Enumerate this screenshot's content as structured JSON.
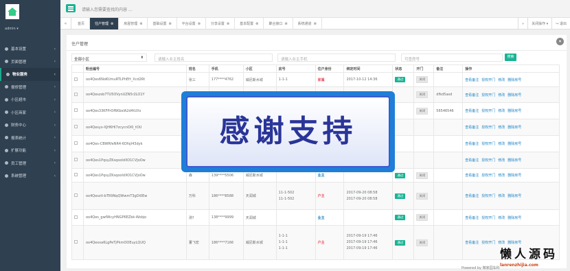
{
  "sidebar": {
    "username": "admin ▾",
    "items": [
      {
        "label": "基本设置",
        "active": false
      },
      {
        "label": "页面管理",
        "active": false
      },
      {
        "label": "物业服务",
        "active": true
      },
      {
        "label": "报修管理",
        "active": false
      },
      {
        "label": "小区超市",
        "active": false
      },
      {
        "label": "小区商家",
        "active": false
      },
      {
        "label": "财务中心",
        "active": false
      },
      {
        "label": "报表统计",
        "active": false
      },
      {
        "label": "扩展功能",
        "active": false
      },
      {
        "label": "员工管理",
        "active": false
      },
      {
        "label": "系统管理",
        "active": false
      }
    ]
  },
  "topbar": {
    "search_placeholder": "请输入您需要查找的内容 ..."
  },
  "tabs": {
    "items": [
      "首页",
      "住户管理",
      "房屋管理",
      "基础设置",
      "平台设置",
      "分享设置",
      "基本配置",
      "聚合接口",
      "系统通道"
    ],
    "active_index": 1,
    "close_ops": "关闭操作 ▾",
    "exit": "退出"
  },
  "panel": {
    "title": "住户管理",
    "filter": {
      "select_value": "全部小区",
      "name_placeholder": "请输入业主姓名",
      "phone_placeholder": "请输入业主手机",
      "room_placeholder": "可查房号",
      "search_label": "搜索"
    },
    "columns": [
      "",
      "粉丝编号",
      "姓名",
      "手机",
      "小区",
      "房号",
      "住户身份",
      "绑定时间",
      "状态",
      "开门",
      "备注",
      "操作"
    ],
    "rows": [
      {
        "openid": "oo4Qes6NoKUmuRTLPhEH_Xcd2Rt",
        "name": "张三",
        "phone": "177****4762",
        "estate": "威尼斯水城",
        "rooms": [
          "1-1-1"
        ],
        "role": "家属",
        "role_type": "red",
        "time": [
          "2017-10-12 14:36"
        ],
        "status": "通过",
        "door": "关闭",
        "note": ""
      },
      {
        "openid": "oo4Qeszsb7TU5OVynUZN5r2LO1Y",
        "name": "",
        "phone": "",
        "estate": "",
        "rooms": [],
        "role": "",
        "role_type": "",
        "time": [],
        "status": "",
        "door": "关闭",
        "note": "dfkd5asd"
      },
      {
        "openid": "oo4Qes33KFPrOf6KbslA2d4tUXs",
        "name": "",
        "phone": "",
        "estate": "",
        "rooms": [],
        "role": "",
        "role_type": "",
        "time": [],
        "status": "",
        "door": "关闭",
        "note": "56546546"
      },
      {
        "openid": "oo4Qesyx-XJH6HI7zcycnOl0_tOU",
        "name": "",
        "phone": "",
        "estate": "",
        "rooms": [],
        "role": "",
        "role_type": "",
        "time": [],
        "status": "",
        "door": "",
        "note": ""
      },
      {
        "openid": "oo4Qes-CBWRfeNR4-6Dfsjl43dyk",
        "name": "",
        "phone": "",
        "estate": "",
        "rooms": [],
        "role": "",
        "role_type": "",
        "time": [],
        "status": "",
        "door": "",
        "note": ""
      },
      {
        "openid": "oo4Qes1PqsyZKsqooIdXO1CVJoOw",
        "name": "",
        "phone": "",
        "estate": "",
        "rooms": [],
        "role": "",
        "role_type": "",
        "time": [],
        "status": "",
        "door": "",
        "note": ""
      },
      {
        "openid": "oo4Qes1PqsyZKsqooIdXO1CVJoOw",
        "name": "森",
        "phone": "139****5506",
        "estate": "威尼斯水城",
        "rooms": [],
        "role": "业主",
        "role_type": "blue",
        "time": [],
        "status": "通过",
        "door": "关闭",
        "note": ""
      },
      {
        "openid": "oo4Qesztl-bTR9NqQWwmT3gDi0Ew",
        "name": "万科",
        "phone": "186****8588",
        "estate": "天润城",
        "rooms": [
          "11-1-502",
          "11-1-502"
        ],
        "role": "户主",
        "role_type": "red",
        "time": [
          "2017-09-20 08:58",
          "2017-09-20 08:58"
        ],
        "status": "通过",
        "door": "关闭",
        "note": ""
      },
      {
        "openid": "oo4Qes_gwfWcyHNGP6EZbk-Wobjo",
        "name": "测?",
        "phone": "138****9999",
        "estate": "天润城",
        "rooms": [],
        "role": "业主",
        "role_type": "blue",
        "time": [],
        "status": "通过",
        "door": "关闭",
        "note": ""
      },
      {
        "openid": "oo4Qexxa6LgPeTjPkmOOEuyLQUQ",
        "name": "董飞宏",
        "phone": "186****7166",
        "estate": "威尼斯水城",
        "rooms": [
          "1-1-1",
          "1-1-1",
          "1-1-1"
        ],
        "role": "户主",
        "role_type": "red",
        "time": [
          "2017-09-19 17:46",
          "2017-09-19 17:46",
          "2017-09-19 17:46"
        ],
        "status": "通过",
        "door": "关闭",
        "note": ""
      }
    ],
    "actions": [
      "查看备注",
      "授权开门",
      "修改",
      "删除房号"
    ]
  },
  "overlay": {
    "text": "感谢支持"
  },
  "watermark": {
    "cn": "懒人源码",
    "en": "lanrenzhijia.com"
  },
  "footer": {
    "text": "Powered by 微家园车科"
  },
  "colors": {
    "sidebar": "#2f4050",
    "accent": "#1ab394",
    "link": "#1c84c6",
    "danger": "#ed5565"
  }
}
